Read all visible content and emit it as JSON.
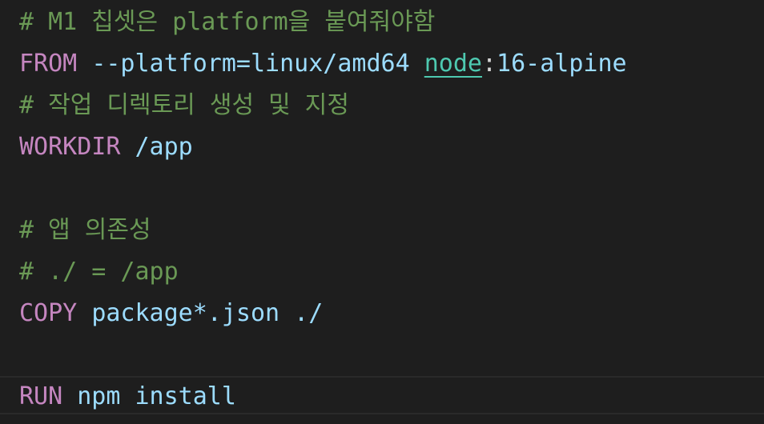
{
  "editor": {
    "lines": [
      {
        "type": "comment",
        "text": "# M1 칩셋은 platform을 붙여줘야함"
      },
      {
        "keyword": "FROM",
        "arg": "--platform=linux/amd64",
        "image": "node",
        "colon": ":",
        "tag": "16-alpine"
      },
      {
        "type": "comment",
        "text": "# 작업 디렉토리 생성 및 지정"
      },
      {
        "keyword": "WORKDIR",
        "arg": "/app"
      },
      {
        "type": "blank",
        "text": ""
      },
      {
        "type": "comment",
        "text": "# 앱 의존성"
      },
      {
        "type": "comment",
        "text": "# ./ = /app"
      },
      {
        "keyword": "COPY",
        "arg": "package*.json ./"
      },
      {
        "type": "blank",
        "text": ""
      },
      {
        "keyword": "RUN",
        "arg": "npm install"
      }
    ]
  }
}
